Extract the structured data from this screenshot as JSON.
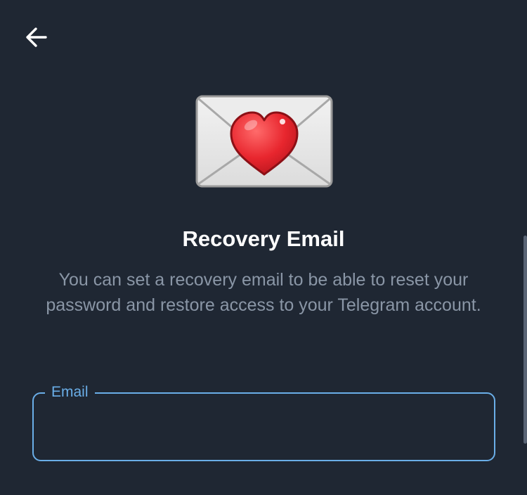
{
  "header": {
    "back_icon": "arrow-left-icon"
  },
  "illustration": {
    "icon": "envelope-with-heart-icon"
  },
  "title": "Recovery Email",
  "description": "You can set a recovery email to be able to reset your password and restore access to your Telegram account.",
  "email_field": {
    "label": "Email",
    "value": ""
  },
  "colors": {
    "background": "#1f2733",
    "accent": "#6aaee8",
    "secondary_text": "#8a96a6",
    "heart": "#e8262e"
  }
}
